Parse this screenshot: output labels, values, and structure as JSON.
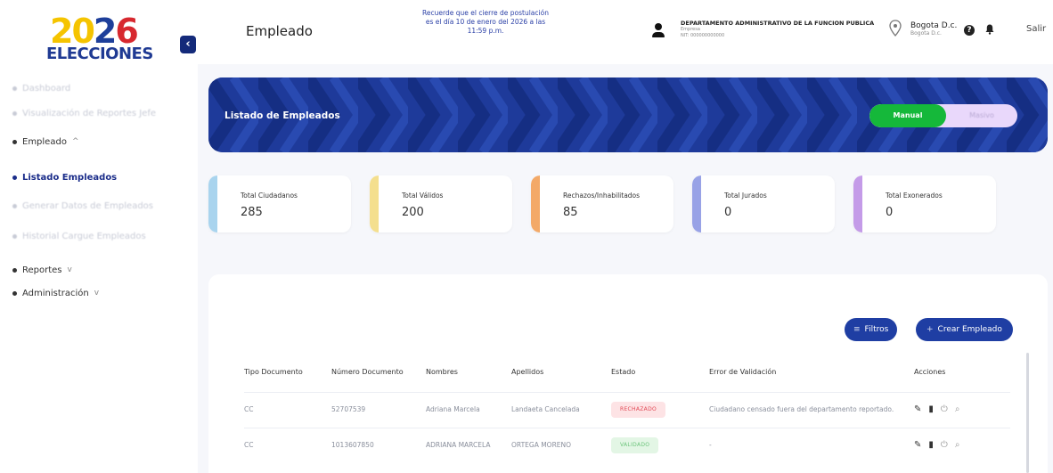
{
  "logo": {
    "year_a": "20",
    "year_b": "2",
    "year_c": "6",
    "word": "ELECCIONES"
  },
  "sidebar": {
    "items": [
      {
        "label": "Dashboard",
        "state": "faded"
      },
      {
        "label": "Visualización de Reportes Jefe",
        "state": "faded"
      },
      {
        "label": "Empleado",
        "state": "normal",
        "chev": "^"
      },
      {
        "label": "Listado Empleados",
        "state": "active"
      },
      {
        "label": "Generar Datos de Empleados",
        "state": "faded"
      },
      {
        "label": "Historial Cargue Empleados",
        "state": "faded"
      },
      {
        "label": "Reportes",
        "state": "normal",
        "chev": "v"
      },
      {
        "label": "Administración",
        "state": "normal",
        "chev": "v"
      }
    ]
  },
  "header": {
    "title": "Empleado",
    "notice": "Recuerde que el cierre de postulación es el día 10 de enero del 2026 a las 11:59 p.m.",
    "entity_name": "DEPARTAMENTO ADMINISTRATIVO DE LA FUNCION PUBLICA",
    "entity_role": "Empresa",
    "entity_nit": "NIT: 000000000000",
    "city": "Bogota D.c.",
    "city_sub": "Bogota D.c.",
    "logout": "Salir"
  },
  "banner": {
    "title": "Listado de Empleados",
    "toggle_on": "Manual",
    "toggle_off": "Masivo"
  },
  "stats": [
    {
      "label": "Total Ciudadanos",
      "value": "285",
      "color": "#a9d4ee"
    },
    {
      "label": "Total Válidos",
      "value": "200",
      "color": "#f4df8e"
    },
    {
      "label": "Rechazos/Inhabilitados",
      "value": "85",
      "color": "#f3a968"
    },
    {
      "label": "Total Jurados",
      "value": "0",
      "color": "#98a2e6"
    },
    {
      "label": "Total Exonerados",
      "value": "0",
      "color": "#c49be8"
    }
  ],
  "actions": {
    "filters": "Filtros",
    "create": "Crear Empleado"
  },
  "table": {
    "headers": [
      "Tipo Documento",
      "Número Documento",
      "Nombres",
      "Apellidos",
      "Estado",
      "Error de Validación",
      "Acciones"
    ],
    "rows": [
      {
        "tipo": "CC",
        "numero": "52707539",
        "nombres": "Adriana Marcela",
        "apellidos": "Landaeta Cancelada",
        "estado": "RECHAZADO",
        "estado_color": "red",
        "error": "Ciudadano censado fuera del departamento reportado."
      },
      {
        "tipo": "CC",
        "numero": "1013607850",
        "nombres": "ADRIANA MARCELA",
        "apellidos": "ORTEGA MORENO",
        "estado": "VALIDADO",
        "estado_color": "green",
        "error": "-"
      }
    ]
  },
  "colors": {
    "primary": "#1f3ea3",
    "banner": "#1e3a9a",
    "toggle_on": "#15b83a"
  }
}
